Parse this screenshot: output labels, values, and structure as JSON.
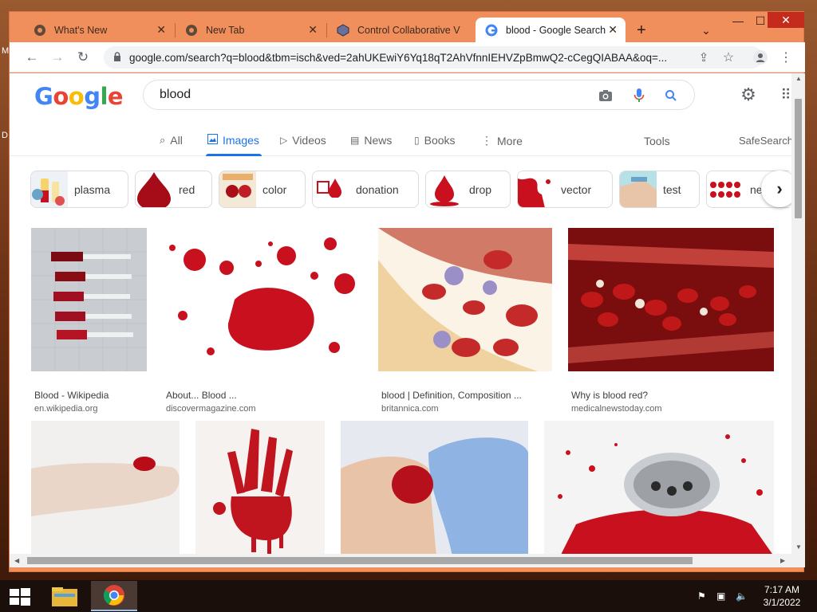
{
  "browser": {
    "tabs": [
      {
        "title": "What's New",
        "icon": "chrome-icon"
      },
      {
        "title": "New Tab",
        "icon": "chrome-icon"
      },
      {
        "title": "Control Collaborative V",
        "icon": "app-icon"
      },
      {
        "title": "blood - Google Search",
        "icon": "google-g-icon",
        "active": true
      }
    ],
    "new_tab": "+",
    "url": "google.com/search?q=blood&tbm=isch&ved=2ahUKEwiY6Yq18qT2AhVfnnIEHVZpBmwQ2-cCegQIABAA&oq=..."
  },
  "desktop": {
    "cut_label_1": "M",
    "cut_label_2": "D"
  },
  "google": {
    "logo": [
      "G",
      "o",
      "o",
      "g",
      "l",
      "e"
    ],
    "logo_colors": [
      "#4285f4",
      "#ea4335",
      "#fbbc05",
      "#4285f4",
      "#34a853",
      "#ea4335"
    ],
    "query": "blood",
    "nav": [
      {
        "label": "All",
        "icon": "search-icon"
      },
      {
        "label": "Images",
        "icon": "image-icon",
        "active": true
      },
      {
        "label": "Videos",
        "icon": "video-icon"
      },
      {
        "label": "News",
        "icon": "news-icon"
      },
      {
        "label": "Books",
        "icon": "book-icon"
      },
      {
        "label": "More",
        "icon": "more-vert-icon"
      }
    ],
    "tools": "Tools",
    "safesearch": "SafeSearch",
    "chips": [
      "plasma",
      "red",
      "color",
      "donation",
      "drop",
      "vector",
      "test",
      "ne"
    ],
    "results": [
      {
        "caption": "Blood - Wikipedia",
        "source": "en.wikipedia.org"
      },
      {
        "caption": "About... Blood ...",
        "source": "discovermagazine.com"
      },
      {
        "caption": "blood | Definition, Composition ...",
        "source": "britannica.com"
      },
      {
        "caption": "Why is blood red?",
        "source": "medicalnewstoday.com"
      }
    ]
  },
  "taskbar": {
    "time": "7:17 AM",
    "date": "3/1/2022"
  },
  "colors": {
    "accent": "#1a73e8",
    "frame": "#f08f5c",
    "blood": "#c8101e"
  }
}
